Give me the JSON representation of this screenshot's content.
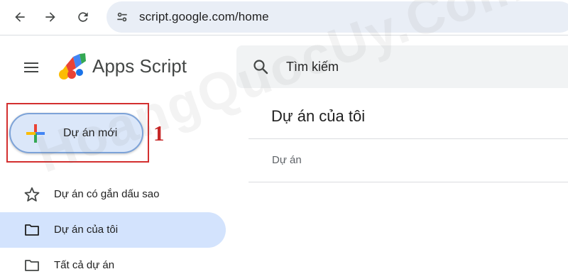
{
  "browser": {
    "url": "script.google.com/home",
    "back_icon": "arrow-back-icon",
    "forward_icon": "arrow-forward-icon",
    "reload_icon": "reload-icon",
    "site_info_icon": "tune-icon"
  },
  "header": {
    "menu_icon": "hamburger-menu-icon",
    "app_name": "Apps Script",
    "search_placeholder": "Tìm kiếm",
    "search_icon": "search-icon"
  },
  "new_project": {
    "label": "Dự án mới",
    "step_number": "1",
    "colors": [
      "#ea4335",
      "#4285f4",
      "#34a853",
      "#fbbc04"
    ]
  },
  "sidebar": {
    "items": [
      {
        "label": "Dự án có gắn dấu sao",
        "icon": "star-icon",
        "active": false
      },
      {
        "label": "Dự án của tôi",
        "icon": "folder-icon",
        "active": true
      },
      {
        "label": "Tất cả dự án",
        "icon": "folder-icon",
        "active": false
      }
    ]
  },
  "main": {
    "title": "Dự án của tôi",
    "column_header": "Dự án"
  },
  "watermark": "HoangQuocUy.Com",
  "colors": {
    "accent": "#d3e3fd",
    "highlight": "#d32f2f",
    "omnibox": "#e9eef6"
  }
}
